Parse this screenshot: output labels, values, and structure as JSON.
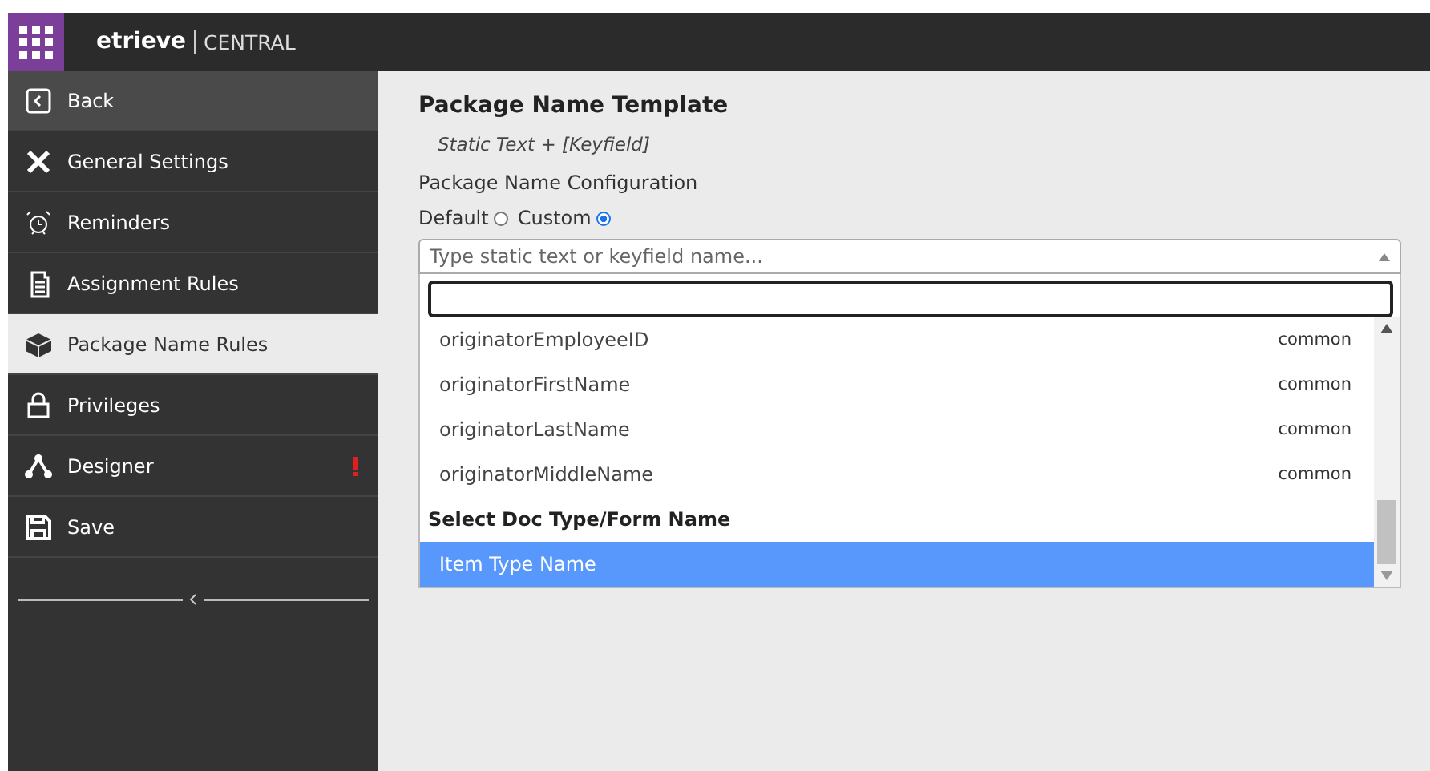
{
  "header": {
    "brand": "etrieve",
    "product": "CENTRAL"
  },
  "sidebar": {
    "items": [
      {
        "label": "Back",
        "kind": "back",
        "selected": false,
        "alert": false
      },
      {
        "label": "General Settings",
        "kind": "tools",
        "selected": false,
        "alert": false
      },
      {
        "label": "Reminders",
        "kind": "alarm",
        "selected": false,
        "alert": false
      },
      {
        "label": "Assignment Rules",
        "kind": "document",
        "selected": false,
        "alert": false
      },
      {
        "label": "Package Name Rules",
        "kind": "package",
        "selected": true,
        "alert": false
      },
      {
        "label": "Privileges",
        "kind": "lock",
        "selected": false,
        "alert": false
      },
      {
        "label": "Designer",
        "kind": "network",
        "selected": false,
        "alert": true
      },
      {
        "label": "Save",
        "kind": "save",
        "selected": false,
        "alert": false
      }
    ]
  },
  "main": {
    "title": "Package Name Template",
    "template": "Static Text + [Keyfield]",
    "config_label": "Package Name Configuration",
    "radios": [
      {
        "label": "Default",
        "selected": false
      },
      {
        "label": "Custom",
        "selected": true
      }
    ],
    "select": {
      "placeholder": "Type static text or keyfield name..."
    },
    "options": [
      {
        "kind": "option",
        "label": "originatorEmployeeID",
        "tag": "common",
        "selected": false
      },
      {
        "kind": "option",
        "label": "originatorFirstName",
        "tag": "common",
        "selected": false
      },
      {
        "kind": "option",
        "label": "originatorLastName",
        "tag": "common",
        "selected": false
      },
      {
        "kind": "option",
        "label": "originatorMiddleName",
        "tag": "common",
        "selected": false
      },
      {
        "kind": "group",
        "label": "Select Doc Type/Form Name"
      },
      {
        "kind": "option",
        "label": "Item Type Name",
        "selected": true
      }
    ]
  }
}
